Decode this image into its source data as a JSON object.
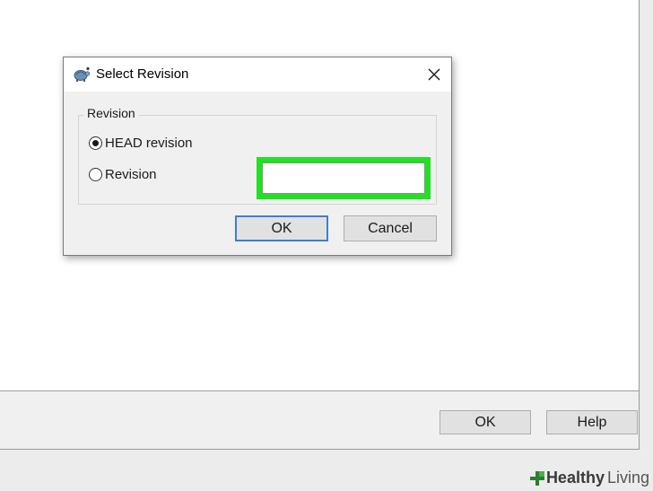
{
  "parent": {
    "ok_label": "OK",
    "help_label": "Help"
  },
  "dialog": {
    "title": "Select Revision",
    "close_icon": "close-icon",
    "group_label": "Revision",
    "options": [
      {
        "label": "HEAD revision",
        "checked": true
      },
      {
        "label": "Revision",
        "checked": false
      }
    ],
    "revision_input_value": "",
    "highlight_color": "#22e022",
    "ok_label": "OK",
    "cancel_label": "Cancel"
  },
  "watermark": {
    "brand_bold": "Healthy",
    "brand_light": "Living"
  }
}
